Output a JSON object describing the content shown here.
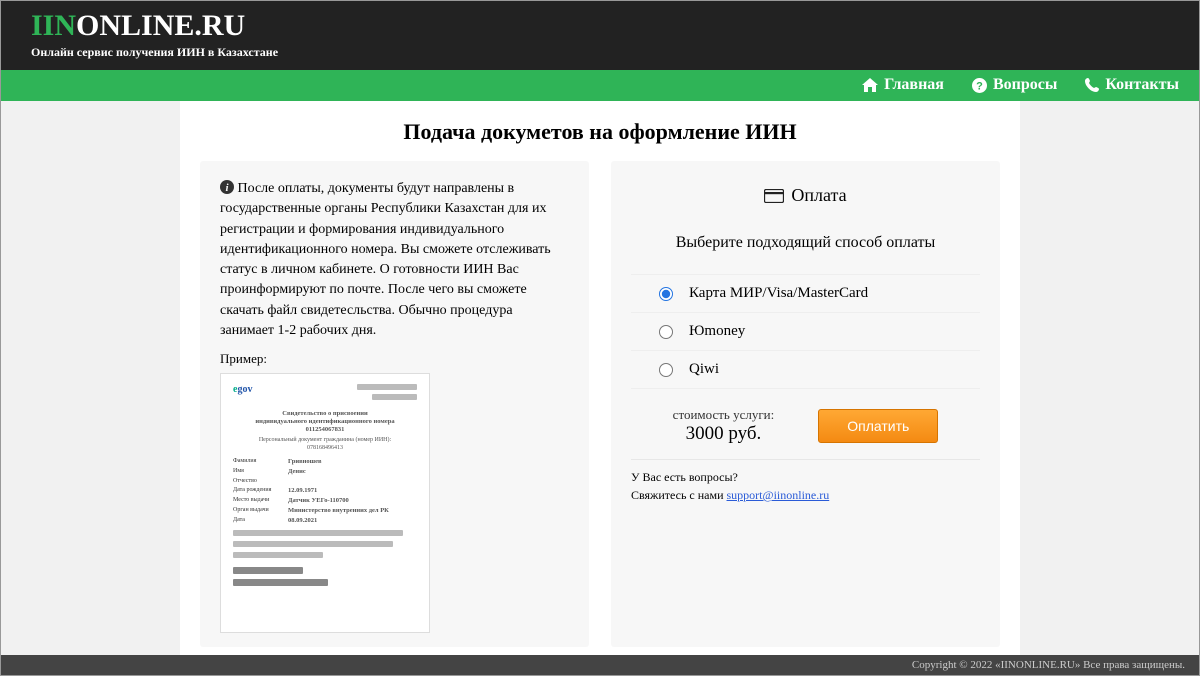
{
  "header": {
    "logo_part1": "IIN",
    "logo_part2": "ONLINE.RU",
    "tagline": "Онлайн сервис получения ИИН в Казахстане"
  },
  "nav": {
    "home": "Главная",
    "faq": "Вопросы",
    "contacts": "Контакты"
  },
  "page_title": "Подача докуметов на оформление ИИН",
  "left": {
    "info_text": "После оплаты, документы будут направлены в государственные органы Республики Казахстан для их регистрации и формирования индивидуального идентификационного номера. Вы сможете отслеживать статус в личном кабинете. О готовности ИИН Вас проинформируют по почте. После чего вы сможете скачать файл свидетесльства. Обычно процедура занимает 1-2 рабочих дня.",
    "example_label": "Пример:",
    "doc": {
      "egov_e": "e",
      "egov_gov": "gov",
      "title": "Свидетельство о присвоении\nиндивидуального идентификационного номера\n011254067831",
      "subtitle": "Персональный документ гражданина (номер ИИН):\n078168496413",
      "rows": [
        {
          "k": "Фамилия",
          "v": "Гривношев"
        },
        {
          "k": "Имя",
          "v": "Денис"
        },
        {
          "k": "Отчество",
          "v": ""
        },
        {
          "k": "Дата рождения",
          "v": "12.09.1971"
        },
        {
          "k": "Место выдачи",
          "v": "Датчик УЕГо-110700"
        },
        {
          "k": "Орган выдачи",
          "v": "Министерство внутренних дел РК"
        },
        {
          "k": "Дата",
          "v": "08.09.2021"
        }
      ]
    }
  },
  "payment": {
    "title": "Оплата",
    "subtitle": "Выберите подходящий способ оплаты",
    "options": [
      "Карта МИР/Visa/MasterCard",
      "Юmoney",
      "Qiwi"
    ],
    "selected_index": 0,
    "cost_label": "стоимость услуги:",
    "cost_value": "3000 руб.",
    "pay_button": "Оплатить",
    "question1": "У Вас есть вопросы?",
    "question2_prefix": "Свяжитесь с нами ",
    "support_email": "support@iinonline.ru"
  },
  "footer": "Copyright © 2022 «IINONLINE.RU» Все права защищены."
}
